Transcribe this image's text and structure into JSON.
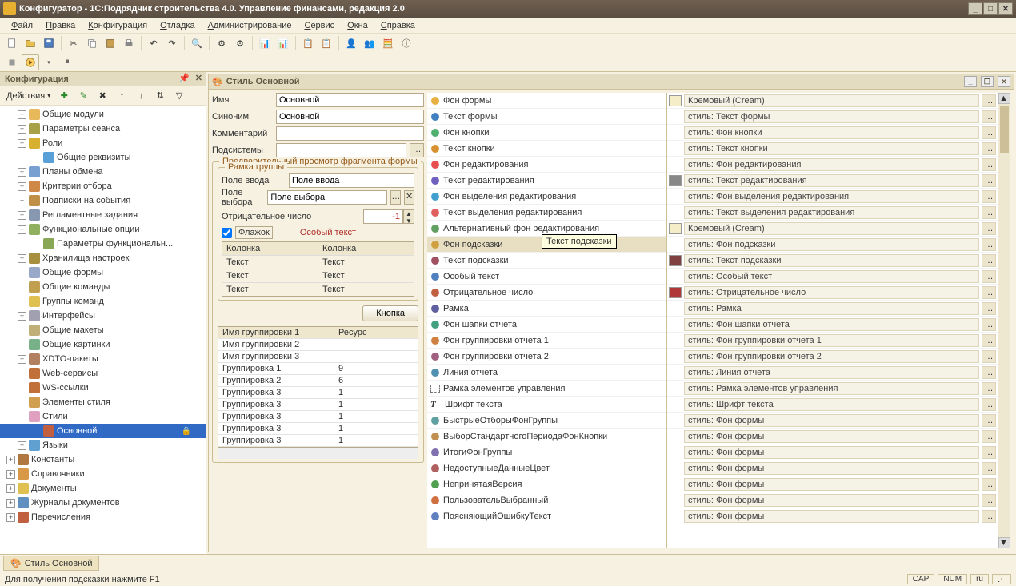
{
  "window": {
    "title": "Конфигуратор - 1С:Подрядчик строительства 4.0. Управление финансами, редакция 2.0"
  },
  "menu": [
    "Файл",
    "Правка",
    "Конфигурация",
    "Отладка",
    "Администрирование",
    "Сервис",
    "Окна",
    "Справка"
  ],
  "panel": {
    "title": "Конфигурация",
    "actions": "Действия"
  },
  "tree": [
    {
      "d": 1,
      "e": "+",
      "label": "Общие модули",
      "ic": "#e8b95a"
    },
    {
      "d": 1,
      "e": "+",
      "label": "Параметры сеанса",
      "ic": "#a8a048"
    },
    {
      "d": 1,
      "e": "+",
      "label": "Роли",
      "ic": "#d8b030"
    },
    {
      "d": 2,
      "e": "",
      "label": "Общие реквизиты",
      "ic": "#5aa0d8"
    },
    {
      "d": 1,
      "e": "+",
      "label": "Планы обмена",
      "ic": "#78a0d0"
    },
    {
      "d": 1,
      "e": "+",
      "label": "Критерии отбора",
      "ic": "#d08848"
    },
    {
      "d": 1,
      "e": "+",
      "label": "Подписки на события",
      "ic": "#c09048"
    },
    {
      "d": 1,
      "e": "+",
      "label": "Регламентные задания",
      "ic": "#8898b0"
    },
    {
      "d": 1,
      "e": "+",
      "label": "Функциональные опции",
      "ic": "#90b060"
    },
    {
      "d": 2,
      "e": "",
      "label": "Параметры функциональн...",
      "ic": "#88a858"
    },
    {
      "d": 1,
      "e": "+",
      "label": "Хранилища настроек",
      "ic": "#a89040"
    },
    {
      "d": 1,
      "e": "",
      "label": "Общие формы",
      "ic": "#98a8c8"
    },
    {
      "d": 1,
      "e": "",
      "label": "Общие команды",
      "ic": "#c0a050"
    },
    {
      "d": 1,
      "e": "",
      "label": "Группы команд",
      "ic": "#e0c050"
    },
    {
      "d": 1,
      "e": "+",
      "label": "Интерфейсы",
      "ic": "#a0a0b0"
    },
    {
      "d": 1,
      "e": "",
      "label": "Общие макеты",
      "ic": "#c0b078"
    },
    {
      "d": 1,
      "e": "",
      "label": "Общие картинки",
      "ic": "#78b088"
    },
    {
      "d": 1,
      "e": "+",
      "label": "XDTO-пакеты",
      "ic": "#b08060"
    },
    {
      "d": 1,
      "e": "",
      "label": "Web-сервисы",
      "ic": "#c07038"
    },
    {
      "d": 1,
      "e": "",
      "label": "WS-ссылки",
      "ic": "#c07038"
    },
    {
      "d": 1,
      "e": "",
      "label": "Элементы стиля",
      "ic": "#d0a050"
    },
    {
      "d": 1,
      "e": "-",
      "label": "Стили",
      "ic": "#e0a0c0"
    },
    {
      "d": 2,
      "e": "",
      "label": "Основной",
      "ic": "#c06040",
      "sel": true,
      "lock": true
    },
    {
      "d": 1,
      "e": "+",
      "label": "Языки",
      "ic": "#60a0d0"
    },
    {
      "d": 0,
      "e": "+",
      "label": "Константы",
      "ic": "#b07840"
    },
    {
      "d": 0,
      "e": "+",
      "label": "Справочники",
      "ic": "#d89848"
    },
    {
      "d": 0,
      "e": "+",
      "label": "Документы",
      "ic": "#e0c050"
    },
    {
      "d": 0,
      "e": "+",
      "label": "Журналы документов",
      "ic": "#6090c0"
    },
    {
      "d": 0,
      "e": "+",
      "label": "Перечисления",
      "ic": "#c06040"
    }
  ],
  "child": {
    "title": "Стиль Основной"
  },
  "form": {
    "name_label": "Имя",
    "name_val": "Основной",
    "synonym_label": "Синоним",
    "synonym_val": "Основной",
    "comment_label": "Комментарий",
    "comment_val": "",
    "subsystems_label": "Подсистемы",
    "subsystems_val": "",
    "preview_legend": "Предварительный просмотр фрагмента формы",
    "group_legend": "Рамка группы",
    "input_label": "Поле ввода",
    "input_val": "Поле ввода",
    "select_label": "Поле выбора",
    "select_val": "Поле выбора",
    "neg_label": "Отрицательное число",
    "neg_val": "-1",
    "checkbox_label": "Флажок",
    "special_text": "Особый текст",
    "col_header": "Колонка",
    "cell_text": "Текст",
    "button_label": "Кнопка"
  },
  "groupings": {
    "h1": "Имя группировки 1",
    "hr": "Ресурс",
    "rows": [
      {
        "n": "Имя группировки 2",
        "v": ""
      },
      {
        "n": "Имя группировки 3",
        "v": ""
      },
      {
        "n": "Группировка 1",
        "v": "9"
      },
      {
        "n": "Группировка 2",
        "v": "6"
      },
      {
        "n": "Группировка 3",
        "v": "1"
      },
      {
        "n": "Группировка 3",
        "v": "1"
      },
      {
        "n": "Группировка 3",
        "v": "1"
      },
      {
        "n": "Группировка 3",
        "v": "1"
      },
      {
        "n": "Группировка 3",
        "v": "1"
      }
    ]
  },
  "styles": [
    {
      "c": "#e8b040",
      "t": "Фон формы"
    },
    {
      "c": "#4080c0",
      "t": "Текст формы"
    },
    {
      "c": "#50b070",
      "t": "Фон кнопки"
    },
    {
      "c": "#d89030",
      "t": "Текст кнопки"
    },
    {
      "c": "#e85050",
      "t": "Фон редактирования"
    },
    {
      "c": "#7060c0",
      "t": "Текст редактирования"
    },
    {
      "c": "#40a0d0",
      "t": "Фон выделения редактирования"
    },
    {
      "c": "#e06060",
      "t": "Текст выделения редактирования"
    },
    {
      "c": "#60a060",
      "t": "Альтернативный фон редактирования"
    },
    {
      "c": "#d0a040",
      "t": "Фон подсказки",
      "sel": true
    },
    {
      "c": "#a05060",
      "t": "Текст подсказки"
    },
    {
      "c": "#5080c0",
      "t": "Особый текст"
    },
    {
      "c": "#c06040",
      "t": "Отрицательное число"
    },
    {
      "c": "#6060a0",
      "t": "Рамка"
    },
    {
      "c": "#40a080",
      "t": "Фон шапки отчета"
    },
    {
      "c": "#d08040",
      "t": "Фон группировки отчета 1"
    },
    {
      "c": "#a06080",
      "t": "Фон группировки отчета 2"
    },
    {
      "c": "#5090b0",
      "t": "Линия отчета"
    },
    {
      "c": "",
      "t": "Рамка элементов управления",
      "glyph": "□"
    },
    {
      "c": "",
      "t": "Шрифт текста",
      "glyph": "T"
    },
    {
      "c": "#60a0a0",
      "t": "БыстрыеОтборыФонГруппы"
    },
    {
      "c": "#c09050",
      "t": "ВыборСтандартногоПериодаФонКнопки"
    },
    {
      "c": "#8070b0",
      "t": "ИтогиФонГруппы"
    },
    {
      "c": "#b06060",
      "t": "НедоступныеДанныеЦвет"
    },
    {
      "c": "#50a050",
      "t": "НепринятаяВерсия"
    },
    {
      "c": "#d07040",
      "t": "ПользовательВыбранный"
    },
    {
      "c": "#6080c0",
      "t": "ПоясняющийОшибкуТекст"
    }
  ],
  "values": [
    {
      "sw": "#f5edc8",
      "t": "Кремовый (Cream)"
    },
    {
      "sw": "",
      "t": "стиль: Текст формы",
      "ns": true
    },
    {
      "sw": "",
      "t": "стиль: Фон кнопки",
      "ns": true
    },
    {
      "sw": "",
      "t": "стиль: Текст кнопки",
      "ns": true
    },
    {
      "sw": "",
      "t": "стиль: Фон редактирования",
      "ns": true
    },
    {
      "sw": "#888888",
      "t": "стиль: Текст редактирования"
    },
    {
      "sw": "",
      "t": "стиль: Фон выделения редактирования",
      "ns": true
    },
    {
      "sw": "",
      "t": "стиль: Текст выделения редактирования",
      "ns": true
    },
    {
      "sw": "#f5edc8",
      "t": "Кремовый (Cream)"
    },
    {
      "sw": "",
      "t": "стиль: Фон подсказки",
      "ns": true
    },
    {
      "sw": "#804040",
      "t": "стиль: Текст подсказки"
    },
    {
      "sw": "",
      "t": "стиль: Особый текст",
      "ns": true
    },
    {
      "sw": "#b03838",
      "t": "стиль: Отрицательное число"
    },
    {
      "sw": "",
      "t": "стиль: Рамка",
      "ns": true
    },
    {
      "sw": "",
      "t": "стиль: Фон шапки отчета",
      "ns": true
    },
    {
      "sw": "",
      "t": "стиль: Фон группировки отчета 1",
      "ns": true
    },
    {
      "sw": "",
      "t": "стиль: Фон группировки отчета 2",
      "ns": true
    },
    {
      "sw": "",
      "t": "стиль: Линия отчета",
      "ns": true
    },
    {
      "sw": "",
      "t": "стиль: Рамка элементов управления",
      "ns": true
    },
    {
      "sw": "",
      "t": "стиль: Шрифт текста",
      "ns": true
    },
    {
      "sw": "",
      "t": "стиль: Фон формы",
      "ns": true
    },
    {
      "sw": "",
      "t": "стиль: Фон формы",
      "ns": true
    },
    {
      "sw": "",
      "t": "стиль: Фон формы",
      "ns": true
    },
    {
      "sw": "",
      "t": "стиль: Фон формы",
      "ns": true
    },
    {
      "sw": "",
      "t": "стиль: Фон формы",
      "ns": true
    },
    {
      "sw": "",
      "t": "стиль: Фон формы",
      "ns": true
    },
    {
      "sw": "",
      "t": "стиль: Фон формы",
      "ns": true
    }
  ],
  "tooltip": "Текст подсказки",
  "taskbar": {
    "tab": "Стиль Основной"
  },
  "status": {
    "hint": "Для получения подсказки нажмите F1",
    "cap": "CAP",
    "num": "NUM",
    "lang": "ru"
  }
}
